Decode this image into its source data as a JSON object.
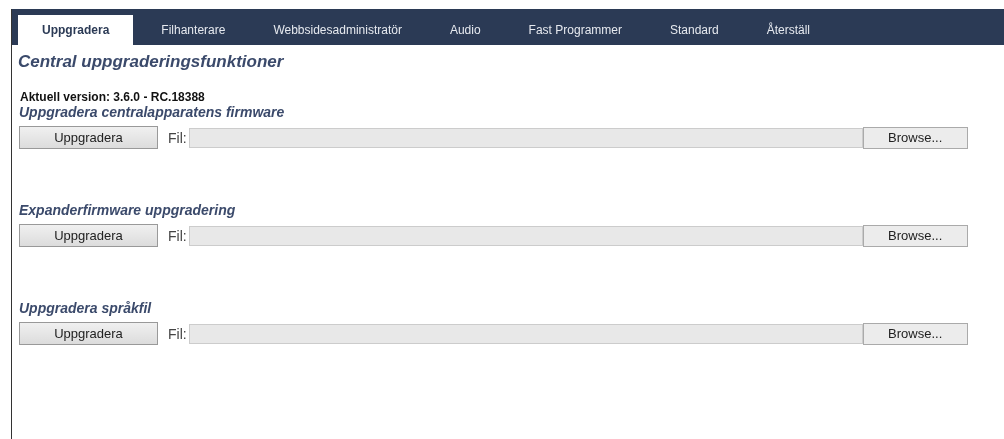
{
  "tabs": [
    {
      "label": "Uppgradera",
      "selected": true
    },
    {
      "label": "Filhanterare",
      "selected": false
    },
    {
      "label": "Webbsidesadministratör",
      "selected": false
    },
    {
      "label": "Audio",
      "selected": false
    },
    {
      "label": "Fast Programmer",
      "selected": false
    },
    {
      "label": "Standard",
      "selected": false
    },
    {
      "label": "Återställ",
      "selected": false
    }
  ],
  "heading": "Central uppgraderingsfunktioner",
  "version": "Aktuell version: 3.6.0 - RC.18388",
  "sections": [
    {
      "title": "Uppgradera centralapparatens firmware",
      "button": "Uppgradera",
      "file_label": "Fil:",
      "browse": "Browse..."
    },
    {
      "title": "Expanderfirmware uppgradering",
      "button": "Uppgradera",
      "file_label": "Fil:",
      "browse": "Browse..."
    },
    {
      "title": "Uppgradera språkfil",
      "button": "Uppgradera",
      "file_label": "Fil:",
      "browse": "Browse..."
    }
  ]
}
